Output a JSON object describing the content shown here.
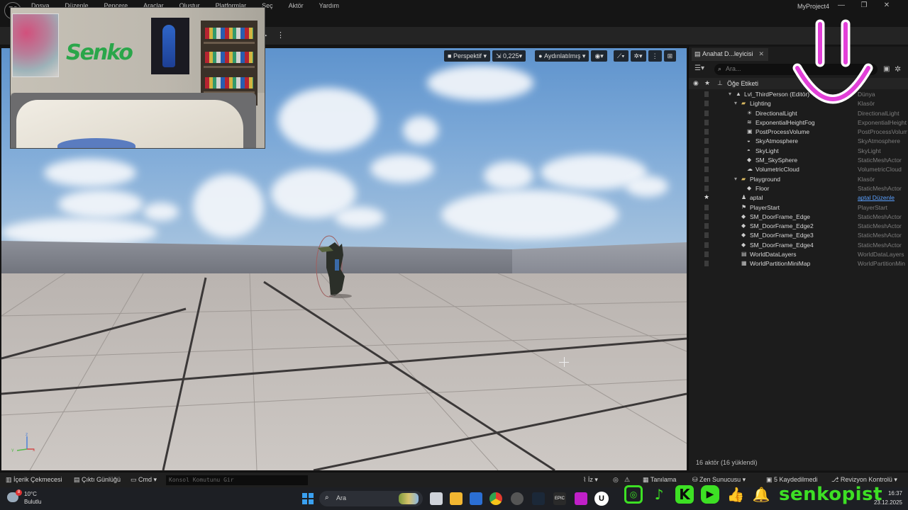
{
  "menubar": {
    "logo": "U",
    "items": [
      "Dosya",
      "Düzenle",
      "Pencere",
      "Araçlar",
      "Oluştur",
      "Platformlar",
      "Seç",
      "Aktör",
      "Yardım"
    ],
    "project": "MyProject4",
    "window_controls": [
      "—",
      "❐",
      "✕"
    ]
  },
  "viewport": {
    "perspective_label": "Perspektif",
    "speed_label": "0,225",
    "lighting_label": "Aydınlatılmış"
  },
  "outliner": {
    "tab_label": "Anahat D...leyicisi",
    "search_placeholder": "Ara...",
    "column_label": "Öğe Etiketi",
    "rows": [
      {
        "name": "Lvl_ThirdPerson (Editör)",
        "type": "Dünya",
        "indent": 0,
        "icon": "level-icon"
      },
      {
        "name": "Lighting",
        "type": "Klasör",
        "indent": 1,
        "icon": "folder-icon"
      },
      {
        "name": "DirectionalLight",
        "type": "DirectionalLight",
        "indent": 2,
        "icon": "light-icon"
      },
      {
        "name": "ExponentialHeightFog",
        "type": "ExponentialHeight",
        "indent": 2,
        "icon": "fog-icon"
      },
      {
        "name": "PostProcessVolume",
        "type": "PostProcessVolum",
        "indent": 2,
        "icon": "volume-icon"
      },
      {
        "name": "SkyAtmosphere",
        "type": "SkyAtmosphere",
        "indent": 2,
        "icon": "atmosphere-icon"
      },
      {
        "name": "SkyLight",
        "type": "SkyLight",
        "indent": 2,
        "icon": "skylight-icon"
      },
      {
        "name": "SM_SkySphere",
        "type": "StaticMeshActor",
        "indent": 2,
        "icon": "mesh-icon"
      },
      {
        "name": "VolumetricCloud",
        "type": "VolumetricCloud",
        "indent": 2,
        "icon": "cloud-icon"
      },
      {
        "name": "Playground",
        "type": "Klasör",
        "indent": 1,
        "icon": "folder-icon"
      },
      {
        "name": "Floor",
        "type": "StaticMeshActor",
        "indent": 2,
        "icon": "mesh-icon"
      },
      {
        "name": "aptal",
        "type": "aptal Düzenle",
        "indent": 1,
        "icon": "pawn-icon",
        "starred": true,
        "link": true
      },
      {
        "name": "PlayerStart",
        "type": "PlayerStart",
        "indent": 1,
        "icon": "playerstart-icon"
      },
      {
        "name": "SM_DoorFrame_Edge",
        "type": "StaticMeshActor",
        "indent": 1,
        "icon": "mesh-icon"
      },
      {
        "name": "SM_DoorFrame_Edge2",
        "type": "StaticMeshActor",
        "indent": 1,
        "icon": "mesh-icon"
      },
      {
        "name": "SM_DoorFrame_Edge3",
        "type": "StaticMeshActor",
        "indent": 1,
        "icon": "mesh-icon"
      },
      {
        "name": "SM_DoorFrame_Edge4",
        "type": "StaticMeshActor",
        "indent": 1,
        "icon": "mesh-icon"
      },
      {
        "name": "WorldDataLayers",
        "type": "WorldDataLayers",
        "indent": 1,
        "icon": "datalayer-icon"
      },
      {
        "name": "WorldPartitionMiniMap",
        "type": "WorldPartitionMin",
        "indent": 1,
        "icon": "minimap-icon"
      }
    ],
    "footer": "16 aktör (16 yüklendi)"
  },
  "statusbar": {
    "content_drawer": "İçerik Çekmecesi",
    "output_log": "Çıktı Günlüğü",
    "cmd": "Cmd",
    "console_placeholder": "Konsol Komutunu Gir",
    "trace": "İz",
    "derived_data": "Tanılama",
    "zen": "Zen Sunucusu",
    "unsaved": "5 Kaydedilmedi",
    "revision": "Revizyon Kontrolü"
  },
  "taskbar": {
    "weather_temp": "10°C",
    "weather_cond": "Bulutlu",
    "weather_badge": "8",
    "search_label": "Ara",
    "time": "16:37",
    "date": "23.12.2025",
    "epic_label": "EPIC"
  },
  "overlay": {
    "webcam_graffiti": "Senko",
    "social_handle": "senkopist",
    "social_icons": [
      "instagram-icon",
      "tiktok-icon",
      "kick-icon",
      "youtube-icon",
      "thumbs-up-icon",
      "bell-icon"
    ],
    "accent_green": "#3de024",
    "smiley_color": "#e23fd8"
  }
}
